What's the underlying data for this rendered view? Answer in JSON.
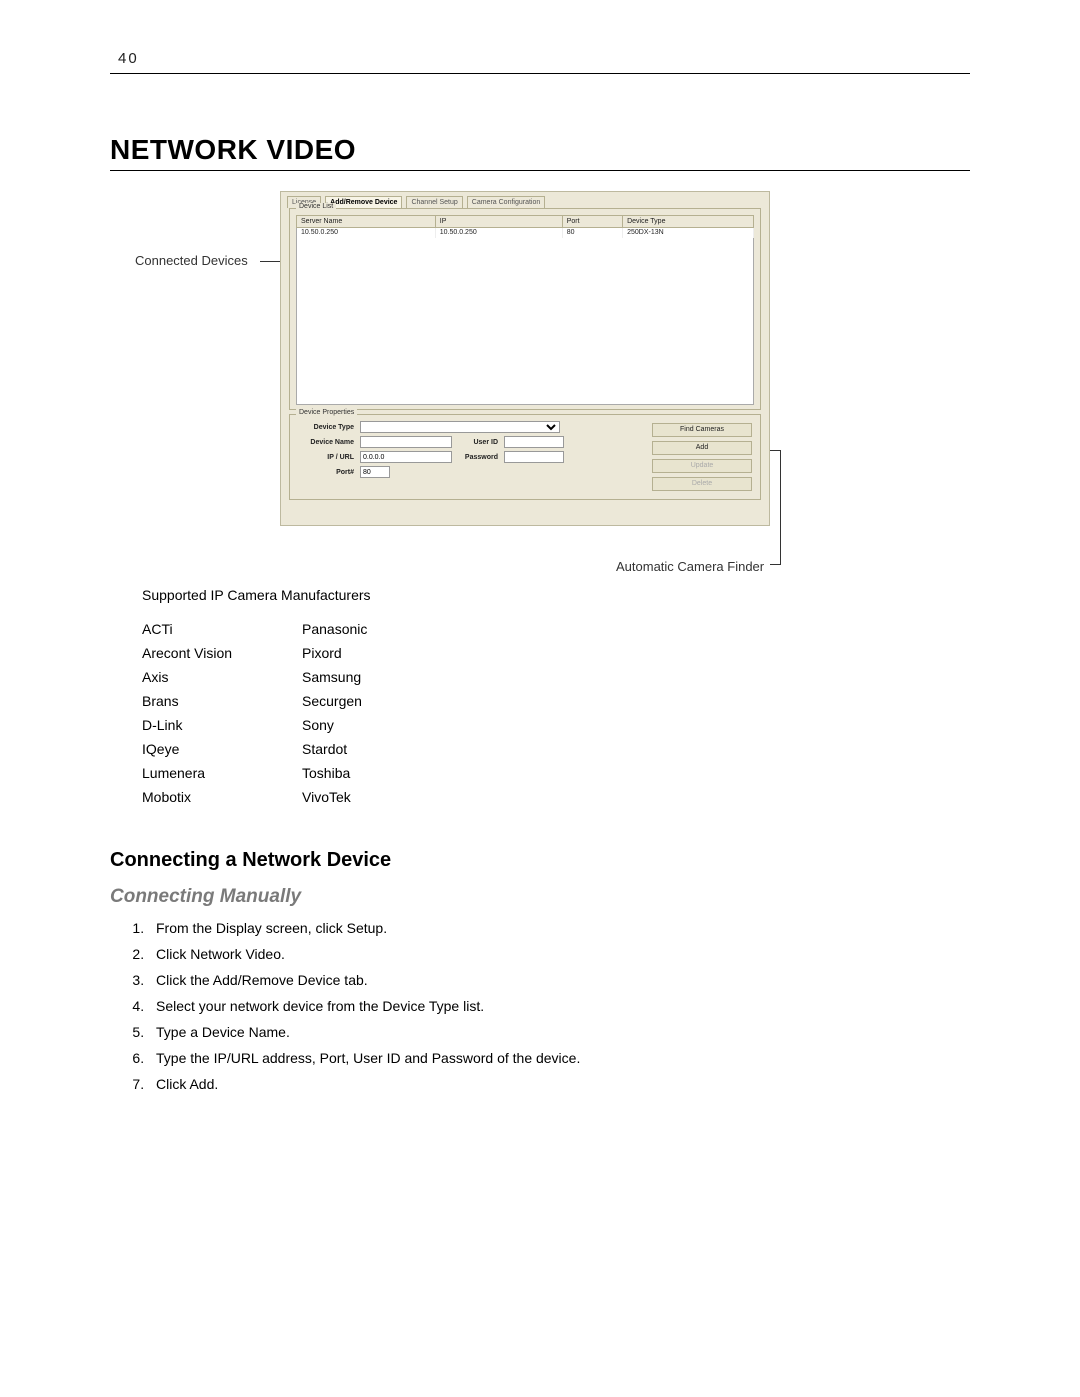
{
  "page_number": "40",
  "title": "NETWORK VIDEO",
  "screenshot": {
    "tabs": [
      "License",
      "Add/Remove Device",
      "Channel Setup",
      "Camera Configuration"
    ],
    "active_tab_index": 1,
    "device_list": {
      "label": "Device List",
      "headers": [
        "Server Name",
        "IP",
        "Port",
        "Device Type"
      ],
      "rows": [
        {
          "server": "10.50.0.250",
          "ip": "10.50.0.250",
          "port": "80",
          "type": "250DX-13N"
        }
      ]
    },
    "device_props": {
      "label": "Device Properties",
      "device_type_label": "Device Type",
      "device_name_label": "Device Name",
      "ip_url_label": "IP / URL",
      "ip_url_value": "0.0.0.0",
      "port_label": "Port#",
      "port_value": "80",
      "user_id_label": "User ID",
      "password_label": "Password"
    },
    "buttons": {
      "find": "Find Cameras",
      "add": "Add",
      "update": "Update",
      "delete": "Delete"
    },
    "callout_left": "Connected Devices",
    "callout_right": "Automatic Camera Finder"
  },
  "manufacturers": {
    "intro": "Supported IP Camera Manufacturers",
    "col1": [
      "ACTi",
      "Arecont Vision",
      "Axis",
      "Brans",
      "D-Link",
      "IQeye",
      "Lumenera",
      "Mobotix"
    ],
    "col2": [
      "Panasonic",
      "Pixord",
      "Samsung",
      "Securgen",
      "Sony",
      "Stardot",
      "Toshiba",
      "VivoTek"
    ]
  },
  "subheading": "Connecting a Network Device",
  "subsubheading": "Connecting Manually",
  "steps": [
    "From the Display screen, click Setup.",
    "Click Network Video.",
    "Click the Add/Remove Device tab.",
    "Select your network device from the Device Type list.",
    "Type a Device Name.",
    "Type the IP/URL address, Port, User ID and Password of the device.",
    "Click Add."
  ]
}
